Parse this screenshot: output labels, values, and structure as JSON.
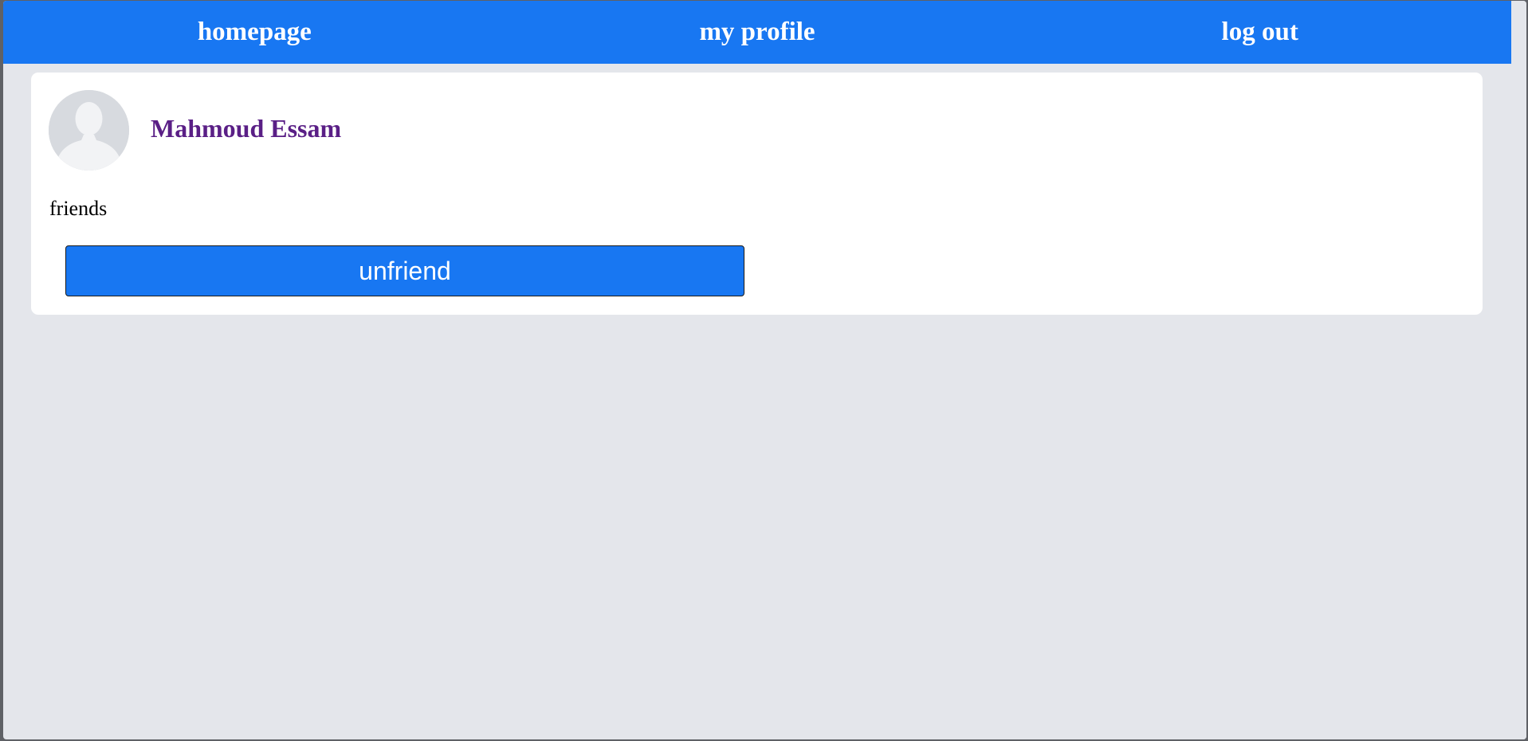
{
  "nav": {
    "homepage_label": "homepage",
    "profile_label": "my profile",
    "logout_label": "log out"
  },
  "profile": {
    "name": "Mahmoud Essam",
    "avatar_icon": "default-user-silhouette-icon",
    "friendship_status": "friends",
    "unfriend_label": "unfriend"
  },
  "colors": {
    "nav_background": "#1877f2",
    "page_background": "#e4e6eb",
    "name_color": "#5a1f86",
    "button_background": "#1877f2"
  }
}
